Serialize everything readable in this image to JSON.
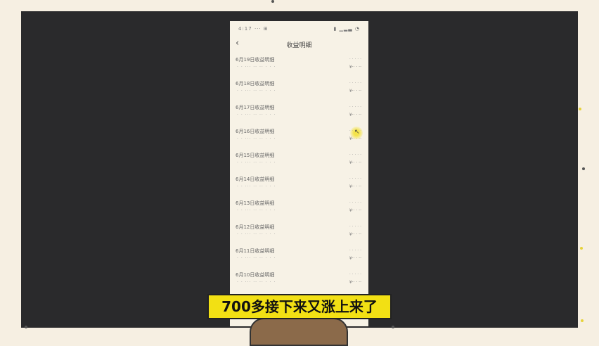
{
  "subtitle": "700多接下来又涨上来了",
  "phone": {
    "status_time": "4:17 ··· ⊞",
    "status_icons": "▮ ▁▂▃ ◔",
    "title": "收益明细",
    "back_label": "‹",
    "rows": [
      {
        "label": "6月19日收益明细",
        "sub": "· · ··· ·· ·· · · ·",
        "v1": "· · · · ·",
        "v2": "¥·· · ··"
      },
      {
        "label": "6月18日收益明细",
        "sub": "· · ··· ·· ·· · · ·",
        "v1": "· · · · ·",
        "v2": "¥·· · ··"
      },
      {
        "label": "6月17日收益明细",
        "sub": "· · ··· ·· ·· · · ·",
        "v1": "· · · · ·",
        "v2": "¥·· · ··"
      },
      {
        "label": "6月16日收益明细",
        "sub": "· · ··· ·· ·· · · ·",
        "v1": "· · · · ·",
        "v2": "¥·· · ··"
      },
      {
        "label": "6月15日收益明细",
        "sub": "· · ··· ·· ·· · · ·",
        "v1": "· · · · ·",
        "v2": "¥·· · ··"
      },
      {
        "label": "6月14日收益明细",
        "sub": "· · ··· ·· ·· · · ·",
        "v1": "· · · · ·",
        "v2": "¥·· · ··"
      },
      {
        "label": "6月13日收益明细",
        "sub": "· · ··· ·· ·· · · ·",
        "v1": "· · · · ·",
        "v2": "¥·· · ··"
      },
      {
        "label": "6月12日收益明细",
        "sub": "· · ··· ·· ·· · · ·",
        "v1": "· · · · ·",
        "v2": "¥·· · ··"
      },
      {
        "label": "6月11日收益明细",
        "sub": "· · ··· ·· ·· · · ·",
        "v1": "· · · · ·",
        "v2": "¥·· · ··"
      },
      {
        "label": "6月10日收益明细",
        "sub": "· · ··· ·· ·· · · ·",
        "v1": "· · · · ·",
        "v2": "¥·· · ··"
      }
    ]
  }
}
